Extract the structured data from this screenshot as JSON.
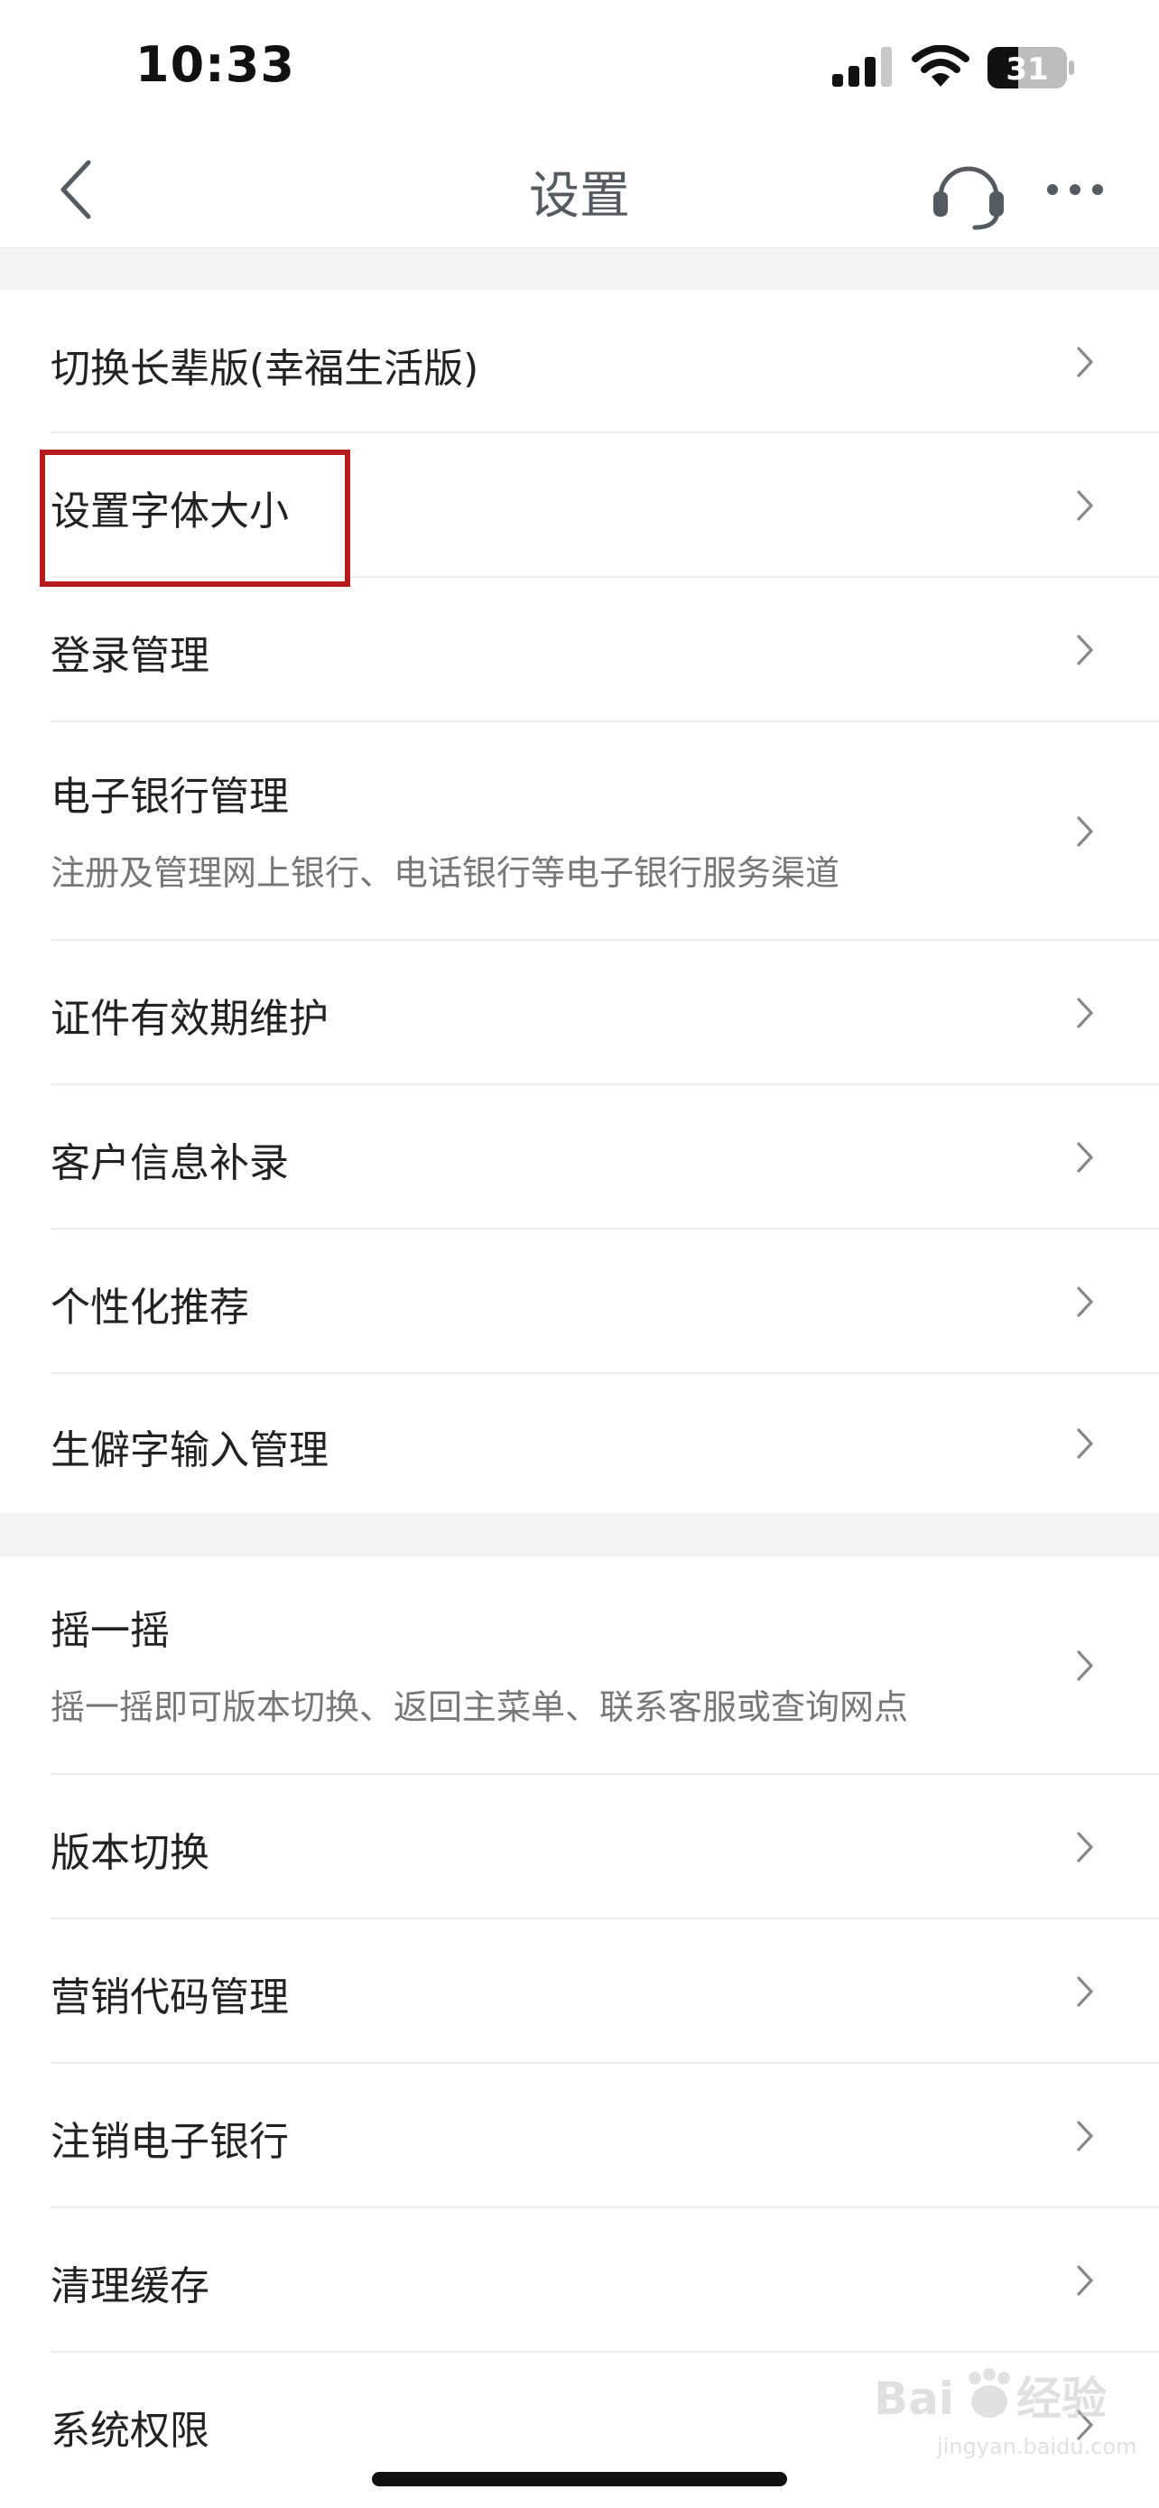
{
  "status_bar": {
    "time": "10:33",
    "battery": "31"
  },
  "nav": {
    "title": "设置"
  },
  "section1": [
    {
      "label": "切换长辈版(幸福生活版)"
    },
    {
      "label": "设置字体大小"
    },
    {
      "label": "登录管理"
    },
    {
      "label": "电子银行管理",
      "sub": "注册及管理网上银行、电话银行等电子银行服务渠道"
    },
    {
      "label": "证件有效期维护"
    },
    {
      "label": "客户信息补录"
    },
    {
      "label": "个性化推荐"
    },
    {
      "label": "生僻字输入管理"
    }
  ],
  "section2": [
    {
      "label": "摇一摇",
      "sub": "摇一摇即可版本切换、返回主菜单、联系客服或查询网点"
    },
    {
      "label": "版本切换"
    },
    {
      "label": "营销代码管理"
    },
    {
      "label": "注销电子银行"
    },
    {
      "label": "清理缓存"
    },
    {
      "label": "系统权限"
    }
  ],
  "watermark": {
    "brand": "Bai",
    "brand2": "经验",
    "url": "jingyan.baidu.com"
  },
  "colors": {
    "highlight": "#b71c1c",
    "separator": "#f4f4f4",
    "subtitle": "#777777"
  }
}
